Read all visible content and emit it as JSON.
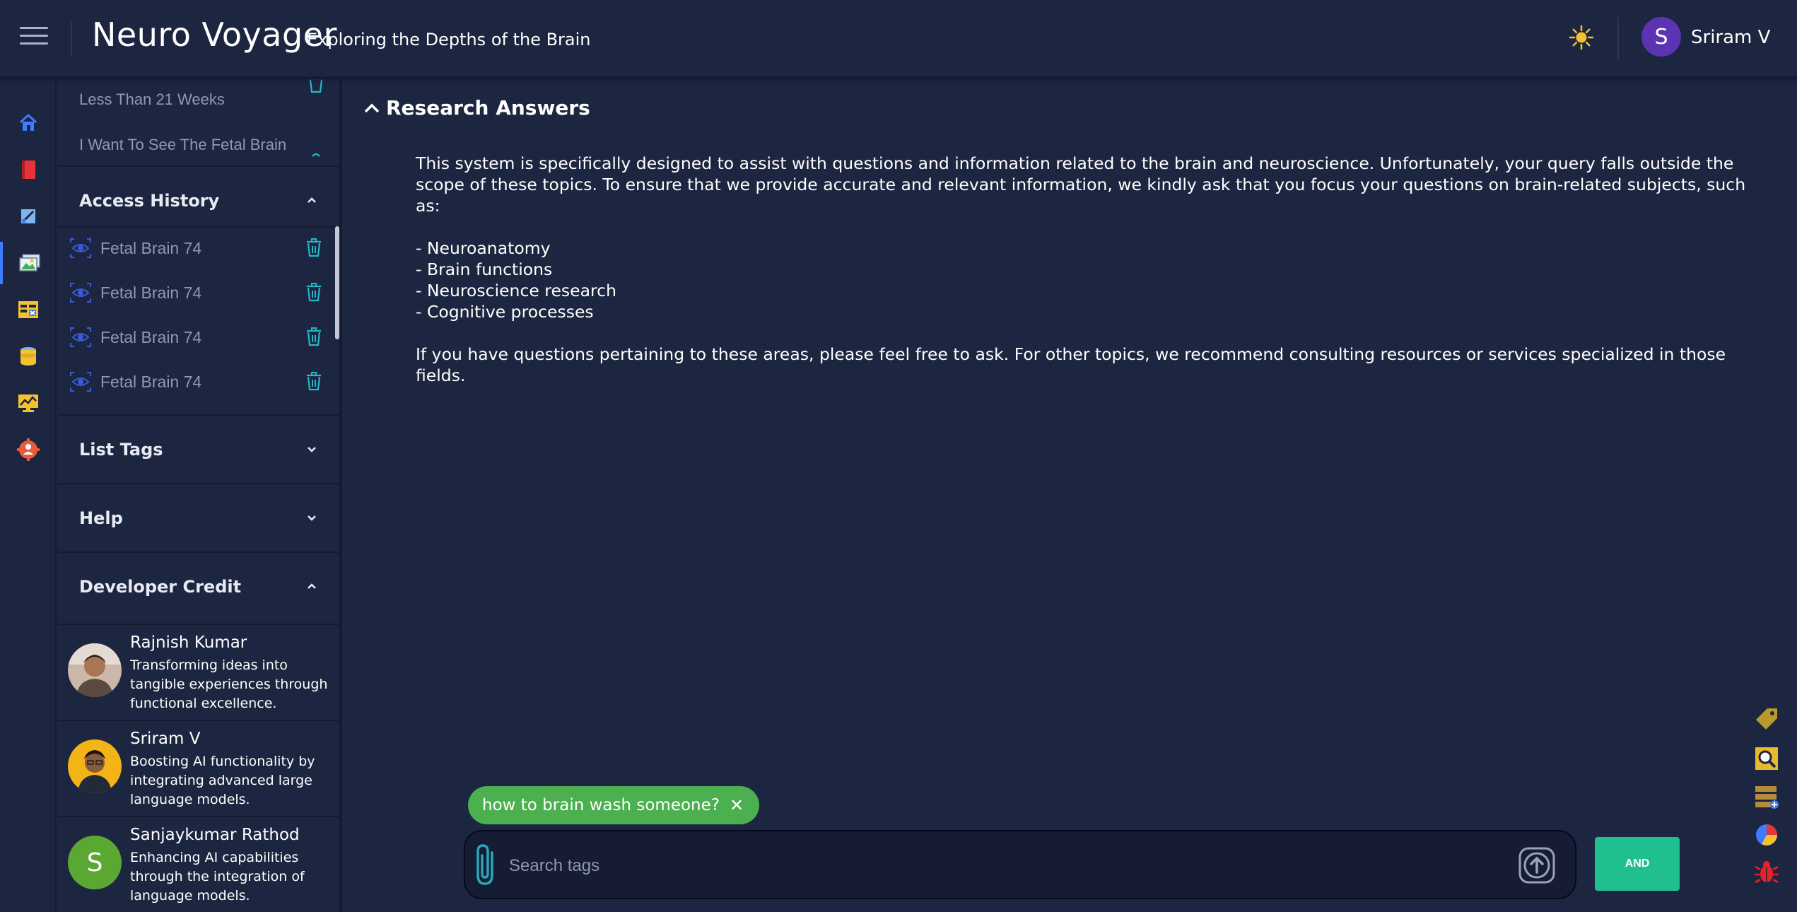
{
  "header": {
    "title": "Neuro Voyager",
    "subtitle": "Exploring the Depths of the Brain",
    "user_initial": "S",
    "user_name": "Sriram V"
  },
  "rail": {
    "items": [
      "home-icon",
      "book-icon",
      "edit-icon",
      "images-icon",
      "table-icon",
      "database-icon",
      "dashboard-icon",
      "settings-icon"
    ],
    "active_index": 3,
    "accent": "#3d7bff"
  },
  "sidebar": {
    "recent": [
      {
        "label": "Less Than 21 Weeks"
      },
      {
        "label": "I Want To See The Fetal Brain"
      }
    ],
    "access_history": {
      "title": "Access History",
      "items": [
        {
          "label": "Fetal Brain 74"
        },
        {
          "label": "Fetal Brain 74"
        },
        {
          "label": "Fetal Brain 74"
        },
        {
          "label": "Fetal Brain 74"
        }
      ]
    },
    "list_tags": {
      "title": "List Tags"
    },
    "help": {
      "title": "Help"
    },
    "developer_credit": {
      "title": "Developer Credit",
      "developers": [
        {
          "name": "Rajnish Kumar",
          "description": "Transforming ideas into tangible experiences through functional excellence."
        },
        {
          "name": "Sriram V",
          "description": "Boosting AI functionality by integrating advanced large language models."
        },
        {
          "name": "Sanjaykumar Rathod",
          "initial": "S",
          "description": "Enhancing AI capabilities through the integration of language models."
        }
      ]
    }
  },
  "main": {
    "section_title": "Research Answers",
    "answer": {
      "intro": "This system is specifically designed to assist with questions and information related to the brain and neuroscience. Unfortunately, your query falls outside the scope of these topics. To ensure that we provide accurate and relevant information, we kindly ask that you focus your questions on brain-related subjects, such as:",
      "bullets": [
        "- Neuroanatomy",
        "- Brain functions",
        "- Neuroscience research",
        "- Cognitive processes"
      ],
      "outro": "If you have questions pertaining to these areas, please feel free to ask. For other topics, we recommend consulting resources or services specialized in those fields."
    },
    "query_chip": "how to brain wash someone?",
    "search": {
      "placeholder": "Search tags"
    },
    "and_button": "AND"
  },
  "tools": [
    "tag-icon",
    "image-search-icon",
    "add-layer-icon",
    "pie-chart-icon",
    "bug-icon"
  ],
  "colors": {
    "background": "#1d2640",
    "chip": "#4caf50",
    "and_button": "#1fbf8f",
    "trash": "#22b7c9",
    "eye": "#3a5bd9",
    "avatar": "#5b33b3"
  }
}
